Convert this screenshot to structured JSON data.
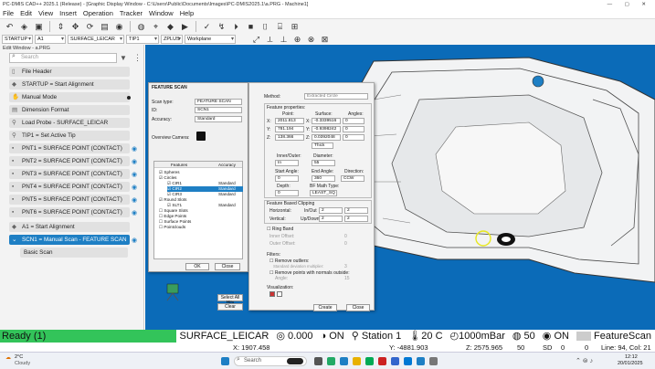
{
  "window": {
    "title": "PC-DMIS CAD++ 2025.1 (Release) - [Graphic Display Window - C:\\Users\\Public\\Documents\\Images\\PC-DMIS2025.1\\a.PRG - Machine1]"
  },
  "menu": [
    "File",
    "Edit",
    "View",
    "Insert",
    "Operation",
    "Tracker",
    "Window",
    "Help"
  ],
  "toolbar2": {
    "mode": "STARTUP",
    "alignment": "A1",
    "workplane_feature": "SURFACE_LEICAR",
    "tip": "TIP1",
    "zplus": "ZPLUS",
    "workplane": "Workplane"
  },
  "edit_window": {
    "title": "Edit Window - a.PRG",
    "search_placeholder": "Search",
    "commands": [
      "File Header",
      "STARTUP = Start Alignment",
      "Manual Mode",
      "Dimension Format",
      "Load Probe - SURFACE_LEICAR",
      "TIP1 = Set Active Tip",
      "PNT1 = SURFACE POINT (CONTACT)",
      "PNT2 = SURFACE POINT (CONTACT)",
      "PNT3 = SURFACE POINT (CONTACT)",
      "PNT4 = SURFACE POINT (CONTACT)",
      "PNT5 = SURFACE POINT (CONTACT)",
      "PNT6 = SURFACE POINT (CONTACT)",
      "A1 = Start Alignment",
      "SCN1 = Manual Scan - FEATURE SCAN",
      "Basic Scan"
    ]
  },
  "feature_scan_dialog": {
    "title": "FEATURE SCAN",
    "scan_type_label": "Scan type:",
    "scan_type_value": "FEATURE SCAN",
    "id_label": "ID:",
    "id_value": "SCN1",
    "accuracy_label": "Accuracy:",
    "accuracy_value": "Standard",
    "overview_camera_label": "Overview Camera:",
    "table_headers": [
      "Features",
      "Accuracy"
    ],
    "tree": [
      {
        "label": "Spheres",
        "accuracy": ""
      },
      {
        "label": "Circles",
        "accuracy": ""
      },
      {
        "label": "CIR1",
        "accuracy": "Standard"
      },
      {
        "label": "CIR2",
        "accuracy": "Standard"
      },
      {
        "label": "CIR3",
        "accuracy": "Standard"
      },
      {
        "label": "Round Slots",
        "accuracy": ""
      },
      {
        "label": "SLT1",
        "accuracy": "Standard"
      },
      {
        "label": "Square Slots",
        "accuracy": ""
      },
      {
        "label": "Edge Points",
        "accuracy": ""
      },
      {
        "label": "Surface Points",
        "accuracy": ""
      },
      {
        "label": "Pointclouds",
        "accuracy": ""
      }
    ],
    "ok_label": "OK",
    "close_label": "Close",
    "select_all_hits": "Select All Hits",
    "clear_label": "Clear"
  },
  "method_dialog": {
    "method_label": "Method:",
    "method_value": "Extracted Circle",
    "feature_properties": "Feature properties:",
    "col_point": "Point:",
    "col_surface": "Surface:",
    "col_angles": "Angles:",
    "rows": [
      {
        "axis": "X:",
        "point": "2011.813",
        "saxis": "X:",
        "surface": "-0.3339516",
        "angle": "0"
      },
      {
        "axis": "Y:",
        "point": "781.194",
        "saxis": "Y:",
        "surface": "-0.9398242",
        "angle": "0"
      },
      {
        "axis": "Z:",
        "point": "138.366",
        "saxis": "Z:",
        "surface": "0.0392048",
        "angle": "0"
      }
    ],
    "thickness": "Thick",
    "inner_outer_label": "Inner/Outer:",
    "inner_outer_value": "In",
    "diameter_label": "Diameter:",
    "diameter_value": "55",
    "start_angle_label": "Start Angle:",
    "start_angle_value": "0",
    "end_angle_label": "End Angle:",
    "end_angle_value": "360",
    "direction_label": "Direction:",
    "direction_value": "CCW",
    "depth_label": "Depth:",
    "depth_value": "0",
    "bf_math_label": "BF Math Type:",
    "bf_math_value": "LEAST_SQ",
    "feature_based_clipping": "Feature Based Clipping",
    "horizontal_label": "Horizontal:",
    "vertical_label": "Vertical:",
    "inout_label": "In/Out",
    "updown_label": "Up/Down",
    "horizontal_value": "2",
    "vertical_value": "2",
    "ring_band": "Ring Band",
    "inner_offset": "Inner Offset:",
    "outer_offset": "Outer Offset:",
    "ring_inner_value": "0",
    "ring_outer_value": "0",
    "filters": "Filters:",
    "remove_outliers": "Remove outliers:",
    "std_dev_label": "Standard deviation multiplier:",
    "std_dev_value": "3",
    "remove_normals": "Remove points with normals outside:",
    "angle_label": "Angle:",
    "normals_value": "15",
    "visualization": "Visualization:",
    "create_label": "Create",
    "close_label": "Close"
  },
  "statusbar": {
    "ready": "Ready (1)",
    "probe": "SURFACE_LEICAR",
    "value": "0.000",
    "on1": "ON",
    "station": "Station 1",
    "temp": "20",
    "temp_unit": "C",
    "pressure": "1000mBar",
    "count": "50",
    "on2": "ON",
    "feature": "FeatureScan"
  },
  "statusbar2": {
    "x": "X: 1907.458",
    "y": "Y: -4881.903",
    "z": "Z: 2575.965",
    "sd_value": "50",
    "sd": "SD",
    "zero1": "0",
    "zero2": "0",
    "line": "Line: 94, Col: 21"
  },
  "taskbar": {
    "weather_temp": "2°C",
    "weather": "Cloudy",
    "search": "Search",
    "time": "12:12",
    "date": "20/01/2025"
  },
  "colors": {
    "accent": "#1e7fc4",
    "cad_background": "#0b6bb8",
    "ready_green": "#33c45a"
  }
}
